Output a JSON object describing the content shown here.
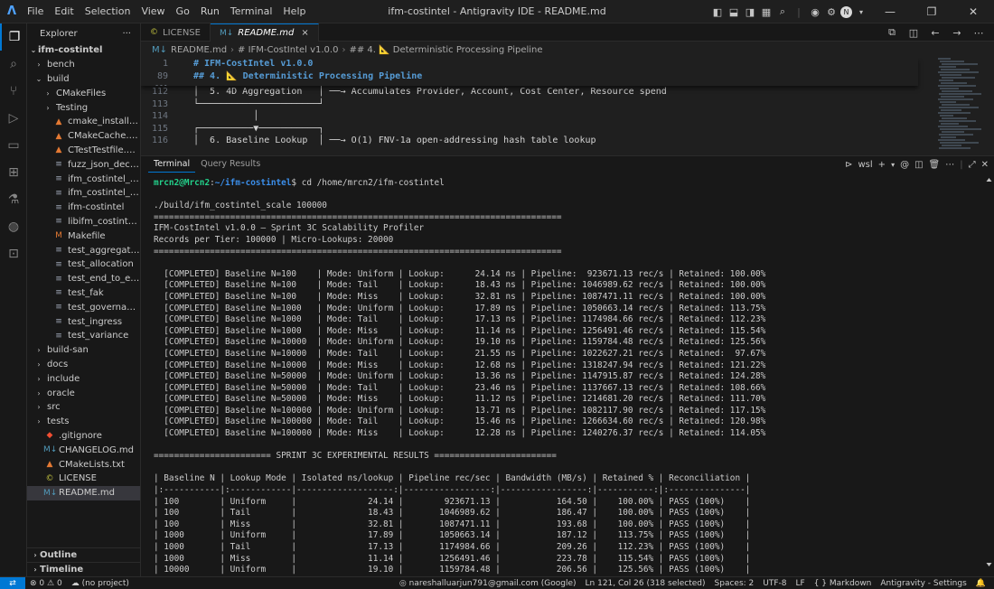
{
  "window": {
    "title": "ifm-costintel - Antigravity IDE - README.md",
    "menus": [
      "File",
      "Edit",
      "Selection",
      "View",
      "Go",
      "Run",
      "Terminal",
      "Help"
    ]
  },
  "sidebar": {
    "header": "Explorer",
    "more": "···",
    "root": "ifm-costintel",
    "items": [
      {
        "label": "bench",
        "depth": 1,
        "kind": "folder",
        "open": false
      },
      {
        "label": "build",
        "depth": 1,
        "kind": "folder",
        "open": true
      },
      {
        "label": "CMakeFiles",
        "depth": 2,
        "kind": "folder",
        "open": false
      },
      {
        "label": "Testing",
        "depth": 2,
        "kind": "folder",
        "open": false
      },
      {
        "label": "cmake_install.cmake",
        "depth": 2,
        "kind": "cmake"
      },
      {
        "label": "CMakeCache.txt",
        "depth": 2,
        "kind": "cmake"
      },
      {
        "label": "CTestTestfile.cmake",
        "depth": 2,
        "kind": "cmake"
      },
      {
        "label": "fuzz_json_decoder",
        "depth": 2,
        "kind": "file"
      },
      {
        "label": "ifm_costintel_bench",
        "depth": 2,
        "kind": "file"
      },
      {
        "label": "ifm_costintel_scale",
        "depth": 2,
        "kind": "file"
      },
      {
        "label": "ifm-costintel",
        "depth": 2,
        "kind": "file"
      },
      {
        "label": "libifm_costintel_lib.a",
        "depth": 2,
        "kind": "file"
      },
      {
        "label": "Makefile",
        "depth": 2,
        "kind": "makefile"
      },
      {
        "label": "test_aggregation",
        "depth": 2,
        "kind": "file"
      },
      {
        "label": "test_allocation",
        "depth": 2,
        "kind": "file"
      },
      {
        "label": "test_end_to_end",
        "depth": 2,
        "kind": "file"
      },
      {
        "label": "test_fak",
        "depth": 2,
        "kind": "file"
      },
      {
        "label": "test_governance",
        "depth": 2,
        "kind": "file"
      },
      {
        "label": "test_ingress",
        "depth": 2,
        "kind": "file"
      },
      {
        "label": "test_variance",
        "depth": 2,
        "kind": "file"
      },
      {
        "label": "build-san",
        "depth": 1,
        "kind": "folder",
        "open": false
      },
      {
        "label": "docs",
        "depth": 1,
        "kind": "folder",
        "open": false
      },
      {
        "label": "include",
        "depth": 1,
        "kind": "folder",
        "open": false
      },
      {
        "label": "oracle",
        "depth": 1,
        "kind": "folder",
        "open": false
      },
      {
        "label": "src",
        "depth": 1,
        "kind": "folder",
        "open": false
      },
      {
        "label": "tests",
        "depth": 1,
        "kind": "folder",
        "open": false
      },
      {
        "label": ".gitignore",
        "depth": 1,
        "kind": "git"
      },
      {
        "label": "CHANGELOG.md",
        "depth": 1,
        "kind": "md"
      },
      {
        "label": "CMakeLists.txt",
        "depth": 1,
        "kind": "cmake"
      },
      {
        "label": "LICENSE",
        "depth": 1,
        "kind": "license"
      },
      {
        "label": "README.md",
        "depth": 1,
        "kind": "md",
        "selected": true
      }
    ],
    "sections": [
      "Outline",
      "Timeline"
    ]
  },
  "editor": {
    "tabs": [
      {
        "label": "LICENSE",
        "active": false
      },
      {
        "label": "README.md",
        "active": true
      }
    ],
    "breadcrumbs": [
      "README.md",
      "# IFM-CostIntel v1.0.0",
      "## 4. 📐 Deterministic Processing Pipeline"
    ],
    "sticky_lines": [
      {
        "num": "1",
        "text": "# IFM-CostIntel v1.0.0"
      },
      {
        "num": "89",
        "text": "## 4. 📐 Deterministic Processing Pipeline"
      }
    ],
    "lines": [
      {
        "num": "112",
        "text": "│  5. 4D Aggregation   │ ──→ Accumulates Provider, Account, Cost Center, Resource spend"
      },
      {
        "num": "113",
        "text": "└──────────────────────┘"
      },
      {
        "num": "114",
        "text": "           │"
      },
      {
        "num": "115",
        "text": "┌──────────▼───────────┐"
      },
      {
        "num": "116",
        "text": "│  6. Baseline Lookup  │ ──→ O(1) FNV-1a open-addressing hash table lookup"
      }
    ]
  },
  "panel": {
    "tabs": [
      "Terminal",
      "Query Results"
    ],
    "shell": "wsl",
    "prompt_user": "mrcn2@Mrcn2",
    "prompt_path": "~/ifm-costintel",
    "command": "$ cd /home/mrcn2/ifm-costintel",
    "output": [
      "",
      "./build/ifm_costintel_scale 100000",
      "================================================================================",
      "IFM-CostIntel v1.0.0 — Sprint 3C Scalability Profiler",
      "Records per Tier: 100000 | Micro-Lookups: 20000",
      "================================================================================",
      "",
      "  [COMPLETED] Baseline N=100    | Mode: Uniform | Lookup:      24.14 ns | Pipeline:  923671.13 rec/s | Retained: 100.00%",
      "  [COMPLETED] Baseline N=100    | Mode: Tail    | Lookup:      18.43 ns | Pipeline: 1046989.62 rec/s | Retained: 100.00%",
      "  [COMPLETED] Baseline N=100    | Mode: Miss    | Lookup:      32.81 ns | Pipeline: 1087471.11 rec/s | Retained: 100.00%",
      "  [COMPLETED] Baseline N=1000   | Mode: Uniform | Lookup:      17.89 ns | Pipeline: 1050663.14 rec/s | Retained: 113.75%",
      "  [COMPLETED] Baseline N=1000   | Mode: Tail    | Lookup:      17.13 ns | Pipeline: 1174984.66 rec/s | Retained: 112.23%",
      "  [COMPLETED] Baseline N=1000   | Mode: Miss    | Lookup:      11.14 ns | Pipeline: 1256491.46 rec/s | Retained: 115.54%",
      "  [COMPLETED] Baseline N=10000  | Mode: Uniform | Lookup:      19.10 ns | Pipeline: 1159784.48 rec/s | Retained: 125.56%",
      "  [COMPLETED] Baseline N=10000  | Mode: Tail    | Lookup:      21.55 ns | Pipeline: 1022627.21 rec/s | Retained:  97.67%",
      "  [COMPLETED] Baseline N=10000  | Mode: Miss    | Lookup:      12.68 ns | Pipeline: 1318247.94 rec/s | Retained: 121.22%",
      "  [COMPLETED] Baseline N=50000  | Mode: Uniform | Lookup:      13.36 ns | Pipeline: 1147915.87 rec/s | Retained: 124.28%",
      "  [COMPLETED] Baseline N=50000  | Mode: Tail    | Lookup:      23.46 ns | Pipeline: 1137667.13 rec/s | Retained: 108.66%",
      "  [COMPLETED] Baseline N=50000  | Mode: Miss    | Lookup:      11.12 ns | Pipeline: 1214681.20 rec/s | Retained: 111.70%",
      "  [COMPLETED] Baseline N=100000 | Mode: Uniform | Lookup:      13.71 ns | Pipeline: 1082117.90 rec/s | Retained: 117.15%",
      "  [COMPLETED] Baseline N=100000 | Mode: Tail    | Lookup:      15.46 ns | Pipeline: 1266634.60 rec/s | Retained: 120.98%",
      "  [COMPLETED] Baseline N=100000 | Mode: Miss    | Lookup:      12.28 ns | Pipeline: 1240276.37 rec/s | Retained: 114.05%",
      "",
      "======================= SPRINT 3C EXPERIMENTAL RESULTS ========================",
      "",
      "| Baseline N | Lookup Mode | Isolated ns/lookup | Pipeline rec/sec | Bandwidth (MB/s) | Retained % | Reconciliation |",
      "|:-----------|:------------|-------------------:|-----------------:|-----------------:|-----------:|:---------------|",
      "| 100        | Uniform     |              24.14 |        923671.13 |           164.50 |    100.00% | PASS (100%)    |",
      "| 100        | Tail        |              18.43 |       1046989.62 |           186.47 |    100.00% | PASS (100%)    |",
      "| 100        | Miss        |              32.81 |       1087471.11 |           193.68 |    100.00% | PASS (100%)    |",
      "| 1000       | Uniform     |              17.89 |       1050663.14 |           187.12 |    113.75% | PASS (100%)    |",
      "| 1000       | Tail        |              17.13 |       1174984.66 |           209.26 |    112.23% | PASS (100%)    |",
      "| 1000       | Miss        |              11.14 |       1256491.46 |           223.78 |    115.54% | PASS (100%)    |",
      "| 10000      | Uniform     |              19.10 |       1159784.48 |           206.56 |    125.56% | PASS (100%)    |"
    ]
  },
  "statusbar": {
    "remote": "⇄",
    "problems_errors": "0",
    "problems_warnings": "0",
    "project": "(no project)",
    "account": "nareshalluarjun791@gmail.com (Google)",
    "cursor": "Ln 121, Col 26 (318 selected)",
    "spaces": "Spaces: 2",
    "encoding": "UTF-8",
    "eol": "LF",
    "language": "Markdown",
    "settings": "Antigravity - Settings"
  },
  "colors": {
    "accent": "#0078d4",
    "prompt_user": "#23d18b",
    "prompt_path": "#3b8eea",
    "md_heading": "#569cd6"
  }
}
